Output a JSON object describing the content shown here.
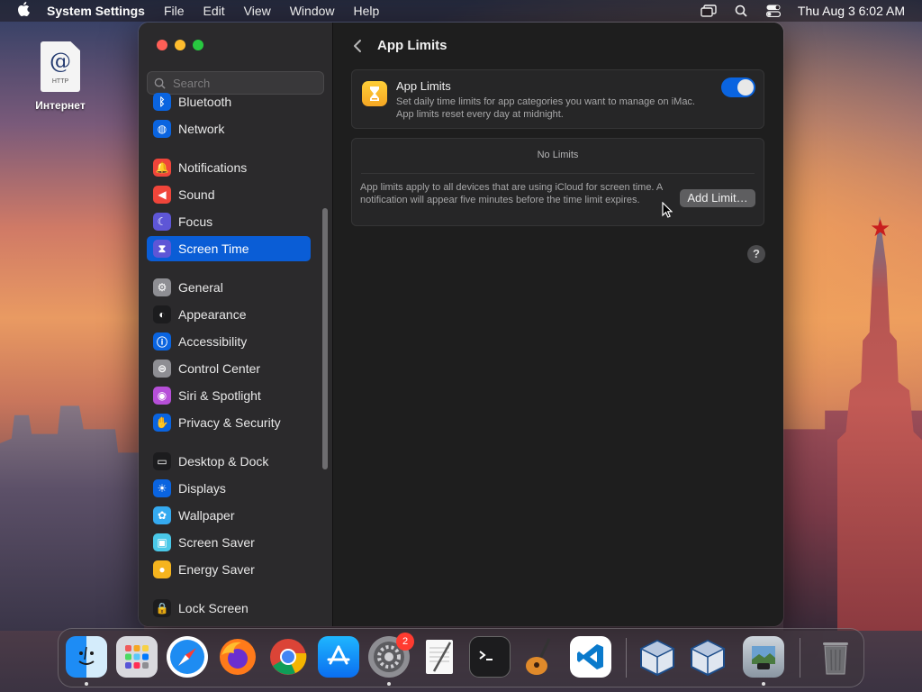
{
  "menubar": {
    "app_name": "System Settings",
    "menus": [
      "File",
      "Edit",
      "View",
      "Window",
      "Help"
    ],
    "clock": "Thu Aug 3  6:02 AM"
  },
  "desktop": {
    "icon_label": "Интернет",
    "icon_doc_text": "HTTP"
  },
  "sidebar": {
    "search_placeholder": "Search",
    "items": [
      {
        "label": "Bluetooth",
        "icon": "bluetooth-icon",
        "color": "#0a64e0"
      },
      {
        "label": "Network",
        "icon": "globe-icon",
        "color": "#0a64e0"
      },
      {
        "label": "Notifications",
        "icon": "bell-icon",
        "color": "#f0453a"
      },
      {
        "label": "Sound",
        "icon": "speaker-icon",
        "color": "#f0453a"
      },
      {
        "label": "Focus",
        "icon": "moon-icon",
        "color": "#5e56d6"
      },
      {
        "label": "Screen Time",
        "icon": "hourglass-icon",
        "color": "#5e56d6"
      },
      {
        "label": "General",
        "icon": "gear-icon",
        "color": "#8e8e93"
      },
      {
        "label": "Appearance",
        "icon": "appearance-icon",
        "color": "#1c1c1e"
      },
      {
        "label": "Accessibility",
        "icon": "accessibility-icon",
        "color": "#0a64e0"
      },
      {
        "label": "Control Center",
        "icon": "toggles-icon",
        "color": "#8e8e93"
      },
      {
        "label": "Siri & Spotlight",
        "icon": "siri-icon",
        "color": "#b64fd8"
      },
      {
        "label": "Privacy & Security",
        "icon": "hand-icon",
        "color": "#0a64e0"
      },
      {
        "label": "Desktop & Dock",
        "icon": "dock-icon",
        "color": "#1c1c1e"
      },
      {
        "label": "Displays",
        "icon": "sun-icon",
        "color": "#0a64e0"
      },
      {
        "label": "Wallpaper",
        "icon": "flower-icon",
        "color": "#35aaf0"
      },
      {
        "label": "Screen Saver",
        "icon": "screensaver-icon",
        "color": "#4ac8e8"
      },
      {
        "label": "Energy Saver",
        "icon": "bulb-icon",
        "color": "#f5b41e"
      },
      {
        "label": "Lock Screen",
        "icon": "lock-icon",
        "color": "#1c1c1e"
      }
    ],
    "selected": "Screen Time"
  },
  "content": {
    "title": "App Limits",
    "app_limits": {
      "title": "App Limits",
      "description": "Set daily time limits for app categories you want to manage on iMac. App limits reset every day at midnight.",
      "enabled": true
    },
    "limits_panel": {
      "empty_text": "No Limits",
      "info": "App limits apply to all devices that are using iCloud for screen time. A notification will appear five minutes before the time limit expires.",
      "add_button": "Add Limit…"
    },
    "help_label": "?"
  },
  "dock": {
    "apps": [
      "Finder",
      "Launchpad",
      "Safari",
      "Firefox",
      "Chrome",
      "App Store",
      "System Settings",
      "TextEdit",
      "Terminal",
      "GarageBand",
      "Visual Studio Code",
      "VirtualBox",
      "VirtualBox VM",
      "Preview",
      "Trash"
    ],
    "settings_badge": "2"
  }
}
